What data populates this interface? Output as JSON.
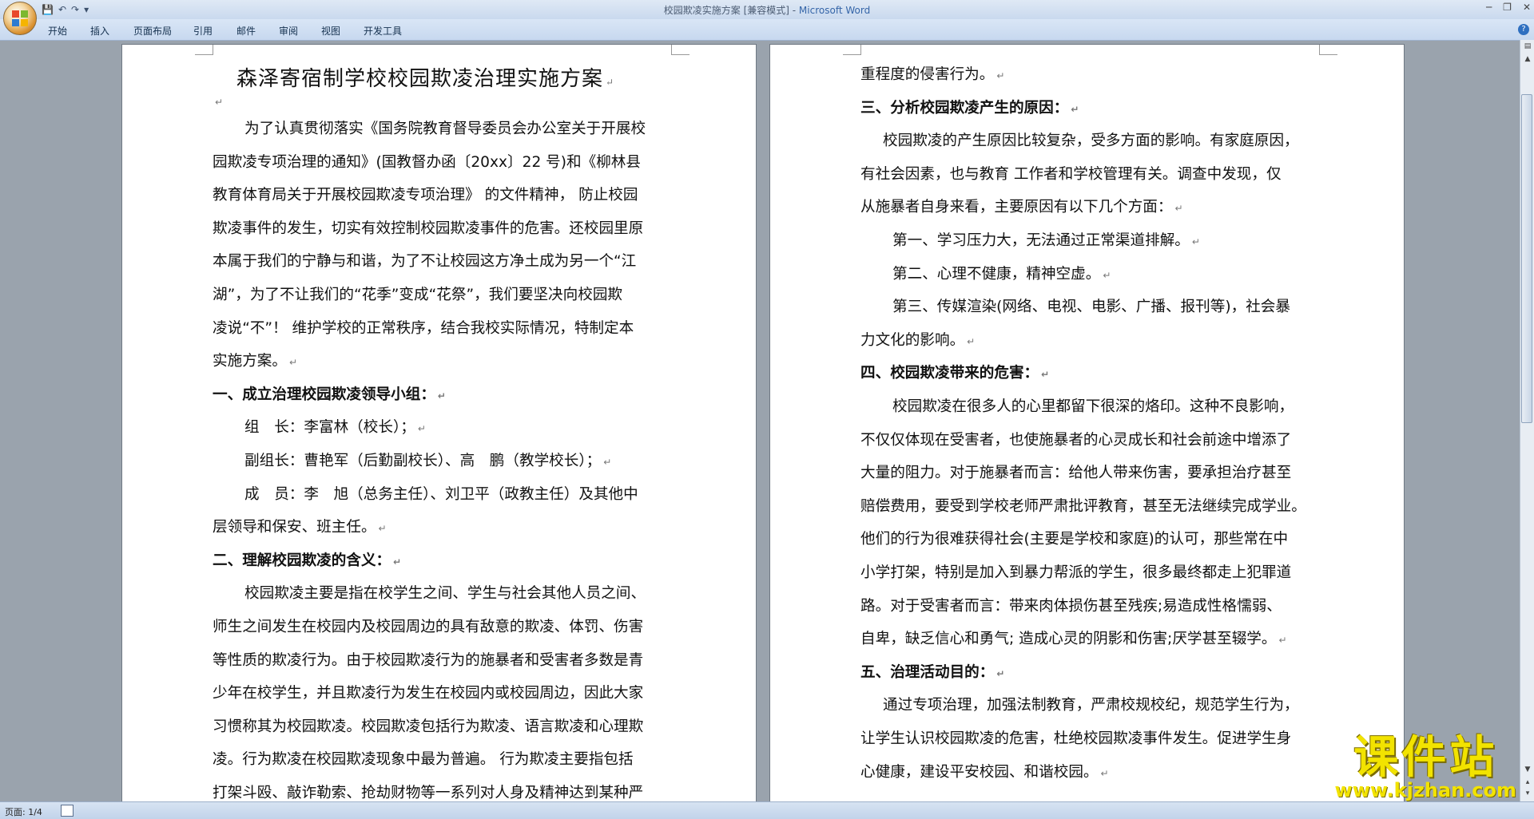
{
  "window": {
    "title_doc": "校园欺凌实施方案 [兼容模式] - ",
    "title_app": "Microsoft Word"
  },
  "ribbon": {
    "tabs": [
      "开始",
      "插入",
      "页面布局",
      "引用",
      "邮件",
      "审阅",
      "视图",
      "开发工具"
    ]
  },
  "page1": {
    "title": "森泽寄宿制学校校园欺凌治理实施方案",
    "lines": [
      {
        "t": "为了认真贯彻落实《国务院教育督导委员会办公室关于开展校",
        "x": 40,
        "b": false,
        "m": false
      },
      {
        "t": "园欺凌专项治理的通知》(国教督办函〔20xx〕22 号)和《柳林县",
        "x": 0,
        "b": false,
        "m": false
      },
      {
        "t": "教育体育局关于开展校园欺凌专项治理》 的文件精神， 防止校园",
        "x": 0,
        "b": false,
        "m": false
      },
      {
        "t": "欺凌事件的发生，切实有效控制校园欺凌事件的危害。还校园里原",
        "x": 0,
        "b": false,
        "m": false
      },
      {
        "t": "本属于我们的宁静与和谐，为了不让校园这方净土成为另一个“江",
        "x": 0,
        "b": false,
        "m": false
      },
      {
        "t": "湖”，为了不让我们的“花季”变成“花祭”，我们要坚决向校园欺",
        "x": 0,
        "b": false,
        "m": false
      },
      {
        "t": "凌说“不”！ 维护学校的正常秩序，结合我校实际情况，特制定本",
        "x": 0,
        "b": false,
        "m": false
      },
      {
        "t": "实施方案。",
        "x": 0,
        "b": false,
        "m": true
      },
      {
        "t": "一、成立治理校园欺凌领导小组：",
        "x": 0,
        "b": true,
        "m": true
      },
      {
        "t": "组　长：李富林（校长）；",
        "x": 40,
        "b": false,
        "m": true
      },
      {
        "t": "副组长：曹艳军（后勤副校长）、高　鹏（教学校长）；",
        "x": 40,
        "b": false,
        "m": true
      },
      {
        "t": "成　员：李　旭（总务主任）、刘卫平（政教主任）及其他中",
        "x": 40,
        "b": false,
        "m": false
      },
      {
        "t": "层领导和保安、班主任。",
        "x": 0,
        "b": false,
        "m": true
      },
      {
        "t": "二、理解校园欺凌的含义：",
        "x": 0,
        "b": true,
        "m": true
      },
      {
        "t": "校园欺凌主要是指在校学生之间、学生与社会其他人员之间、",
        "x": 40,
        "b": false,
        "m": false
      },
      {
        "t": "师生之间发生在校园内及校园周边的具有敌意的欺凌、体罚、伤害",
        "x": 0,
        "b": false,
        "m": false
      },
      {
        "t": "等性质的欺凌行为。由于校园欺凌行为的施暴者和受害者多数是青",
        "x": 0,
        "b": false,
        "m": false
      },
      {
        "t": "少年在校学生，并且欺凌行为发生在校园内或校园周边，因此大家",
        "x": 0,
        "b": false,
        "m": false
      },
      {
        "t": "习惯称其为校园欺凌。校园欺凌包括行为欺凌、语言欺凌和心理欺",
        "x": 0,
        "b": false,
        "m": false
      },
      {
        "t": "凌。行为欺凌在校园欺凌现象中最为普遍。 行为欺凌主要指包括",
        "x": 0,
        "b": false,
        "m": false
      },
      {
        "t": "打架斗殴、敲诈勒索、抢劫财物等一系列对人身及精神达到某种严",
        "x": 0,
        "b": false,
        "m": false
      }
    ]
  },
  "page2": {
    "lines": [
      {
        "t": "重程度的侵害行为。",
        "x": 0,
        "b": false,
        "m": true
      },
      {
        "t": "三、分析校园欺凌产生的原因：",
        "x": 0,
        "b": true,
        "m": true
      },
      {
        "t": "校园欺凌的产生原因比较复杂，受多方面的影响。有家庭原因，",
        "x": 28,
        "b": false,
        "m": false
      },
      {
        "t": "有社会因素，也与教育 工作者和学校管理有关。调查中发现，仅",
        "x": 0,
        "b": false,
        "m": false
      },
      {
        "t": "从施暴者自身来看，主要原因有以下几个方面：",
        "x": 0,
        "b": false,
        "m": true
      },
      {
        "t": "第一、学习压力大，无法通过正常渠道排解。",
        "x": 40,
        "b": false,
        "m": true
      },
      {
        "t": "第二、心理不健康，精神空虚。",
        "x": 40,
        "b": false,
        "m": true
      },
      {
        "t": "第三、传媒渲染(网络、电视、电影、广播、报刊等)，社会暴",
        "x": 40,
        "b": false,
        "m": false
      },
      {
        "t": "力文化的影响。",
        "x": 0,
        "b": false,
        "m": true
      },
      {
        "t": "四、校园欺凌带来的危害：",
        "x": 0,
        "b": true,
        "m": true
      },
      {
        "t": "校园欺凌在很多人的心里都留下很深的烙印。这种不良影响，",
        "x": 40,
        "b": false,
        "m": false
      },
      {
        "t": "不仅仅体现在受害者，也使施暴者的心灵成长和社会前途中增添了",
        "x": 0,
        "b": false,
        "m": false
      },
      {
        "t": "大量的阻力。对于施暴者而言：给他人带来伤害，要承担治疗甚至",
        "x": 0,
        "b": false,
        "m": false
      },
      {
        "t": "赔偿费用，要受到学校老师严肃批评教育，甚至无法继续完成学业。",
        "x": 0,
        "b": false,
        "m": false
      },
      {
        "t": "他们的行为很难获得社会(主要是学校和家庭)的认可，那些常在中",
        "x": 0,
        "b": false,
        "m": false
      },
      {
        "t": "小学打架，特别是加入到暴力帮派的学生，很多最终都走上犯罪道",
        "x": 0,
        "b": false,
        "m": false
      },
      {
        "t": "路。对于受害者而言：带来肉体损伤甚至残疾;易造成性格懦弱、",
        "x": 0,
        "b": false,
        "m": false
      },
      {
        "t": "自卑，缺乏信心和勇气; 造成心灵的阴影和伤害;厌学甚至辍学。",
        "x": 0,
        "b": false,
        "m": true
      },
      {
        "t": "五、治理活动目的：",
        "x": 0,
        "b": true,
        "m": true
      },
      {
        "t": "通过专项治理，加强法制教育，严肃校规校纪，规范学生行为，",
        "x": 28,
        "b": false,
        "m": false
      },
      {
        "t": "让学生认识校园欺凌的危害，杜绝校园欺凌事件发生。促进学生身",
        "x": 0,
        "b": false,
        "m": false
      },
      {
        "t": "心健康，建设平安校园、和谐校园。",
        "x": 0,
        "b": false,
        "m": true
      }
    ]
  },
  "para_mark": "↵",
  "status": {
    "page": "页面: 1/4"
  },
  "watermark": {
    "title": "课件站",
    "url": "www.kjzhan.com"
  }
}
